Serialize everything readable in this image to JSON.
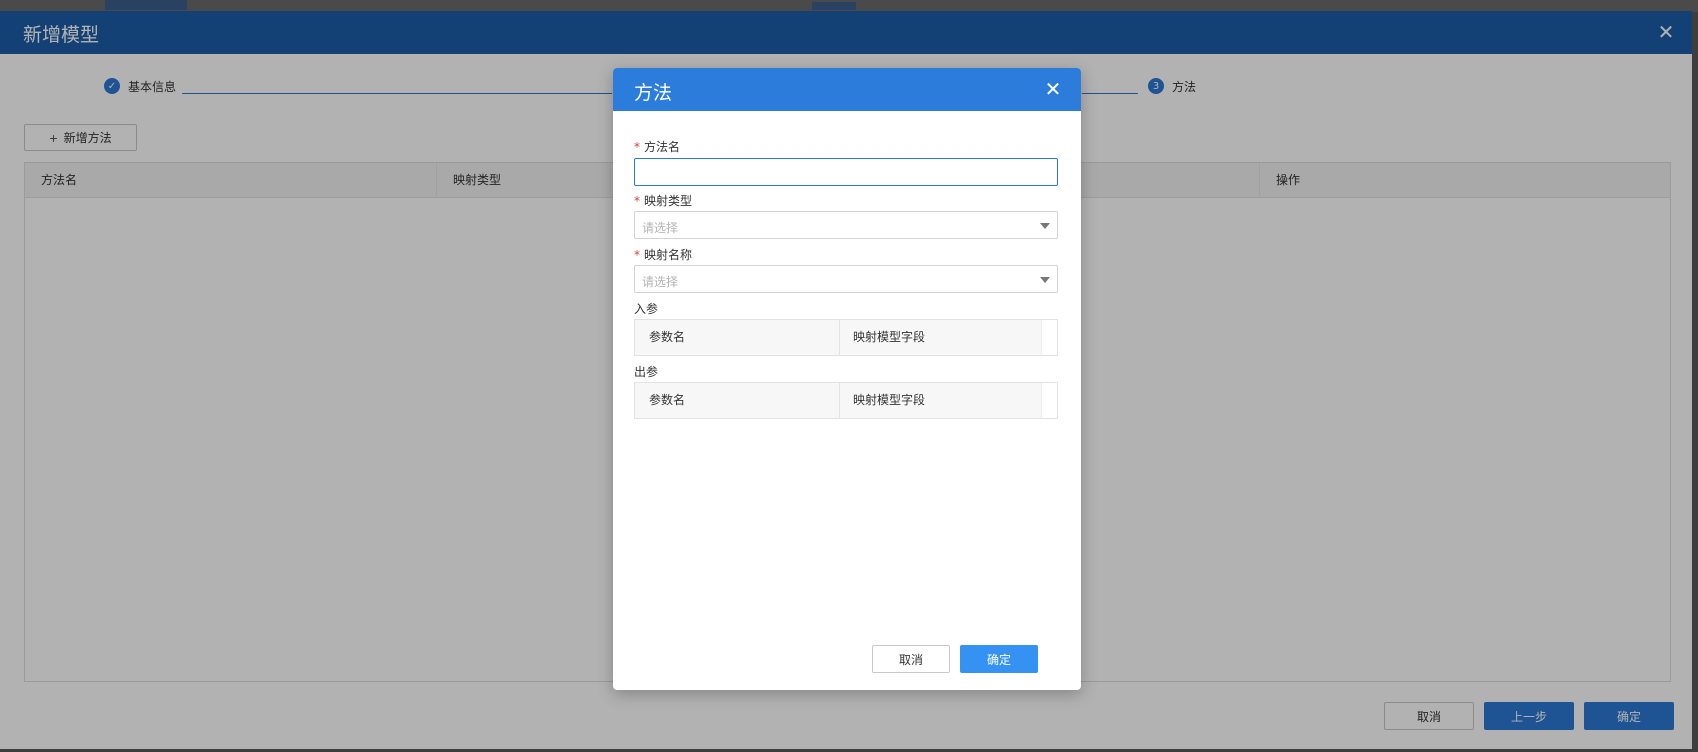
{
  "outer": {
    "title": "新增模型",
    "steps": [
      {
        "number": "",
        "label": "基本信息",
        "state": "done"
      },
      {
        "number": "3",
        "label": "方法",
        "state": "active"
      }
    ],
    "add_method_label": "新增方法",
    "table_headers": [
      "方法名",
      "映射类型",
      "操作"
    ],
    "footer": {
      "cancel_label": "取消",
      "prev_label": "上一步",
      "confirm_label": "确定"
    }
  },
  "modal": {
    "title": "方法",
    "fields": {
      "method_name_label": "方法名",
      "method_name_value": "",
      "mapping_type_label": "映射类型",
      "mapping_type_placeholder": "请选择",
      "mapping_name_label": "映射名称",
      "mapping_name_placeholder": "请选择"
    },
    "input_params": {
      "label": "入参",
      "headers": [
        "参数名",
        "映射模型字段"
      ]
    },
    "output_params": {
      "label": "出参",
      "headers": [
        "参数名",
        "映射模型字段"
      ]
    },
    "buttons": {
      "cancel_label": "取消",
      "confirm_label": "确定"
    }
  },
  "colors": {
    "outer_header": "#1e5ea8",
    "modal_header": "#2c7ddb",
    "primary": "#2c78d4",
    "required": "#e23b2e"
  }
}
